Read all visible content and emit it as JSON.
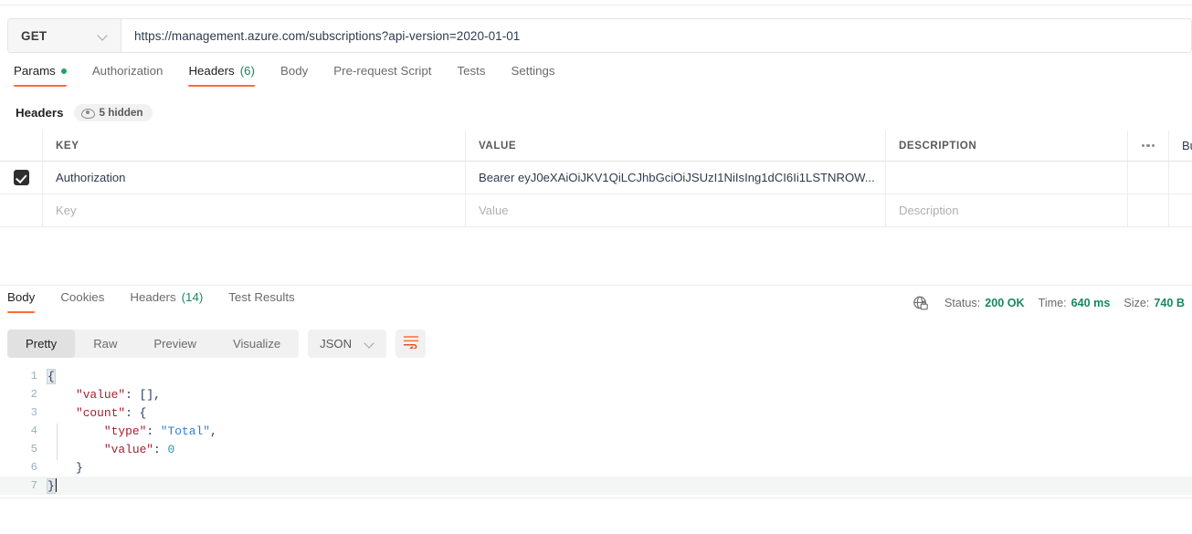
{
  "request": {
    "method": "GET",
    "url": "https://management.azure.com/subscriptions?api-version=2020-01-01",
    "tabs": [
      {
        "label": "Params",
        "badge_dot": true,
        "active": false
      },
      {
        "label": "Authorization",
        "active": false
      },
      {
        "label": "Headers",
        "count": "(6)",
        "active": true
      },
      {
        "label": "Body",
        "active": false
      },
      {
        "label": "Pre-request Script",
        "active": false
      },
      {
        "label": "Tests",
        "active": false
      },
      {
        "label": "Settings",
        "active": false
      }
    ],
    "headers_section": {
      "title": "Headers",
      "hidden_badge": "5 hidden",
      "columns": [
        "KEY",
        "VALUE",
        "DESCRIPTION"
      ],
      "bulk_edit_label": "Bu",
      "rows": [
        {
          "checked": true,
          "key": "Authorization",
          "value": "Bearer eyJ0eXAiOiJKV1QiLCJhbGciOiJSUzI1NiIsIng1dCI6Ii1LSTNROW...",
          "description": ""
        }
      ],
      "placeholder_row": {
        "key": "Key",
        "value": "Value",
        "description": "Description"
      }
    }
  },
  "response": {
    "tabs": [
      {
        "label": "Body",
        "active": true
      },
      {
        "label": "Cookies",
        "active": false
      },
      {
        "label": "Headers",
        "count": "(14)",
        "active": false
      },
      {
        "label": "Test Results",
        "active": false
      }
    ],
    "status": {
      "status_label": "Status:",
      "status_value": "200 OK",
      "time_label": "Time:",
      "time_value": "640 ms",
      "size_label": "Size:",
      "size_value": "740 B",
      "icon": "globe-lock-icon"
    },
    "view_modes": [
      {
        "label": "Pretty",
        "active": true
      },
      {
        "label": "Raw",
        "active": false
      },
      {
        "label": "Preview",
        "active": false
      },
      {
        "label": "Visualize",
        "active": false
      }
    ],
    "format": "JSON",
    "wrap_icon": "wrap-text-icon",
    "body_lines": [
      {
        "num": "1",
        "segments": [
          {
            "t": "{",
            "c": "p brace-hl"
          }
        ]
      },
      {
        "num": "2",
        "segments": [
          {
            "t": "    ",
            "c": ""
          },
          {
            "t": "\"value\"",
            "c": "k"
          },
          {
            "t": ": ",
            "c": "p"
          },
          {
            "t": "[]",
            "c": "p"
          },
          {
            "t": ",",
            "c": "p"
          }
        ]
      },
      {
        "num": "3",
        "segments": [
          {
            "t": "    ",
            "c": ""
          },
          {
            "t": "\"count\"",
            "c": "k"
          },
          {
            "t": ": ",
            "c": "p"
          },
          {
            "t": "{",
            "c": "p"
          }
        ]
      },
      {
        "num": "4",
        "segments": [
          {
            "t": "        ",
            "c": ""
          },
          {
            "t": "\"type\"",
            "c": "k"
          },
          {
            "t": ": ",
            "c": "p"
          },
          {
            "t": "\"Total\"",
            "c": "s"
          },
          {
            "t": ",",
            "c": "p"
          }
        ]
      },
      {
        "num": "5",
        "segments": [
          {
            "t": "        ",
            "c": ""
          },
          {
            "t": "\"value\"",
            "c": "k"
          },
          {
            "t": ": ",
            "c": "p"
          },
          {
            "t": "0",
            "c": "n"
          }
        ]
      },
      {
        "num": "6",
        "segments": [
          {
            "t": "    ",
            "c": ""
          },
          {
            "t": "}",
            "c": "p"
          }
        ]
      },
      {
        "num": "7",
        "segments": [
          {
            "t": "}",
            "c": "p brace-hl"
          }
        ],
        "current": true,
        "caret": true
      }
    ]
  },
  "colors": {
    "accent": "#ff6c37",
    "success": "#1a8662",
    "json_key": "#a11f30",
    "json_string": "#2f7fd0",
    "json_number": "#1b9aa8",
    "text": "#2f3b4e",
    "muted": "#6b6b6b"
  }
}
